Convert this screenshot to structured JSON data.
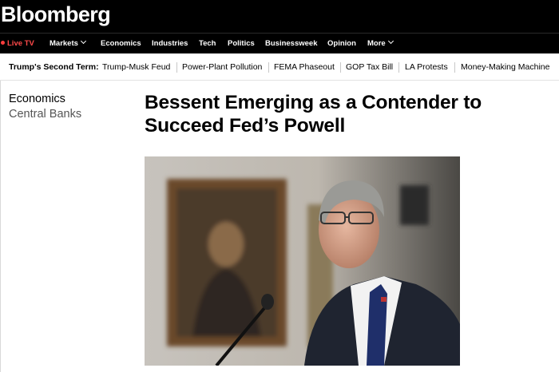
{
  "brand": {
    "logo": "Bloomberg"
  },
  "nav": {
    "live_tv": "Live TV",
    "items": [
      "Markets",
      "Economics",
      "Industries",
      "Tech",
      "Politics",
      "Businessweek",
      "Opinion",
      "More"
    ]
  },
  "trending": {
    "title": "Trump's Second Term:",
    "items": [
      "Trump-Musk Feud",
      "Power-Plant Pollution",
      "FEMA Phaseout",
      "GOP Tax Bill",
      "LA Protests",
      "Money-Making Machine"
    ]
  },
  "article": {
    "section": "Economics",
    "subsection": "Central Banks",
    "headline": "Bessent Emerging as a Contender to Succeed Fed’s Powell"
  },
  "colors": {
    "live_accent": "#ff4a4a",
    "background": "#ffffff",
    "header": "#000000"
  },
  "icons": {
    "more_menu": "chevron-down-icon",
    "live": "live-dot-icon"
  }
}
